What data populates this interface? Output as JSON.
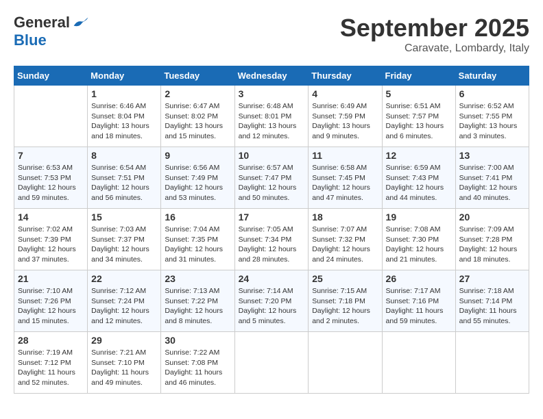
{
  "header": {
    "logo": {
      "general": "General",
      "blue": "Blue"
    },
    "title": "September 2025",
    "subtitle": "Caravate, Lombardy, Italy"
  },
  "calendar": {
    "days": [
      "Sunday",
      "Monday",
      "Tuesday",
      "Wednesday",
      "Thursday",
      "Friday",
      "Saturday"
    ],
    "weeks": [
      [
        {
          "day": null
        },
        {
          "day": "1",
          "sunrise": "Sunrise: 6:46 AM",
          "sunset": "Sunset: 8:04 PM",
          "daylight": "Daylight: 13 hours and 18 minutes."
        },
        {
          "day": "2",
          "sunrise": "Sunrise: 6:47 AM",
          "sunset": "Sunset: 8:02 PM",
          "daylight": "Daylight: 13 hours and 15 minutes."
        },
        {
          "day": "3",
          "sunrise": "Sunrise: 6:48 AM",
          "sunset": "Sunset: 8:01 PM",
          "daylight": "Daylight: 13 hours and 12 minutes."
        },
        {
          "day": "4",
          "sunrise": "Sunrise: 6:49 AM",
          "sunset": "Sunset: 7:59 PM",
          "daylight": "Daylight: 13 hours and 9 minutes."
        },
        {
          "day": "5",
          "sunrise": "Sunrise: 6:51 AM",
          "sunset": "Sunset: 7:57 PM",
          "daylight": "Daylight: 13 hours and 6 minutes."
        },
        {
          "day": "6",
          "sunrise": "Sunrise: 6:52 AM",
          "sunset": "Sunset: 7:55 PM",
          "daylight": "Daylight: 13 hours and 3 minutes."
        }
      ],
      [
        {
          "day": "7",
          "sunrise": "Sunrise: 6:53 AM",
          "sunset": "Sunset: 7:53 PM",
          "daylight": "Daylight: 12 hours and 59 minutes."
        },
        {
          "day": "8",
          "sunrise": "Sunrise: 6:54 AM",
          "sunset": "Sunset: 7:51 PM",
          "daylight": "Daylight: 12 hours and 56 minutes."
        },
        {
          "day": "9",
          "sunrise": "Sunrise: 6:56 AM",
          "sunset": "Sunset: 7:49 PM",
          "daylight": "Daylight: 12 hours and 53 minutes."
        },
        {
          "day": "10",
          "sunrise": "Sunrise: 6:57 AM",
          "sunset": "Sunset: 7:47 PM",
          "daylight": "Daylight: 12 hours and 50 minutes."
        },
        {
          "day": "11",
          "sunrise": "Sunrise: 6:58 AM",
          "sunset": "Sunset: 7:45 PM",
          "daylight": "Daylight: 12 hours and 47 minutes."
        },
        {
          "day": "12",
          "sunrise": "Sunrise: 6:59 AM",
          "sunset": "Sunset: 7:43 PM",
          "daylight": "Daylight: 12 hours and 44 minutes."
        },
        {
          "day": "13",
          "sunrise": "Sunrise: 7:00 AM",
          "sunset": "Sunset: 7:41 PM",
          "daylight": "Daylight: 12 hours and 40 minutes."
        }
      ],
      [
        {
          "day": "14",
          "sunrise": "Sunrise: 7:02 AM",
          "sunset": "Sunset: 7:39 PM",
          "daylight": "Daylight: 12 hours and 37 minutes."
        },
        {
          "day": "15",
          "sunrise": "Sunrise: 7:03 AM",
          "sunset": "Sunset: 7:37 PM",
          "daylight": "Daylight: 12 hours and 34 minutes."
        },
        {
          "day": "16",
          "sunrise": "Sunrise: 7:04 AM",
          "sunset": "Sunset: 7:35 PM",
          "daylight": "Daylight: 12 hours and 31 minutes."
        },
        {
          "day": "17",
          "sunrise": "Sunrise: 7:05 AM",
          "sunset": "Sunset: 7:34 PM",
          "daylight": "Daylight: 12 hours and 28 minutes."
        },
        {
          "day": "18",
          "sunrise": "Sunrise: 7:07 AM",
          "sunset": "Sunset: 7:32 PM",
          "daylight": "Daylight: 12 hours and 24 minutes."
        },
        {
          "day": "19",
          "sunrise": "Sunrise: 7:08 AM",
          "sunset": "Sunset: 7:30 PM",
          "daylight": "Daylight: 12 hours and 21 minutes."
        },
        {
          "day": "20",
          "sunrise": "Sunrise: 7:09 AM",
          "sunset": "Sunset: 7:28 PM",
          "daylight": "Daylight: 12 hours and 18 minutes."
        }
      ],
      [
        {
          "day": "21",
          "sunrise": "Sunrise: 7:10 AM",
          "sunset": "Sunset: 7:26 PM",
          "daylight": "Daylight: 12 hours and 15 minutes."
        },
        {
          "day": "22",
          "sunrise": "Sunrise: 7:12 AM",
          "sunset": "Sunset: 7:24 PM",
          "daylight": "Daylight: 12 hours and 12 minutes."
        },
        {
          "day": "23",
          "sunrise": "Sunrise: 7:13 AM",
          "sunset": "Sunset: 7:22 PM",
          "daylight": "Daylight: 12 hours and 8 minutes."
        },
        {
          "day": "24",
          "sunrise": "Sunrise: 7:14 AM",
          "sunset": "Sunset: 7:20 PM",
          "daylight": "Daylight: 12 hours and 5 minutes."
        },
        {
          "day": "25",
          "sunrise": "Sunrise: 7:15 AM",
          "sunset": "Sunset: 7:18 PM",
          "daylight": "Daylight: 12 hours and 2 minutes."
        },
        {
          "day": "26",
          "sunrise": "Sunrise: 7:17 AM",
          "sunset": "Sunset: 7:16 PM",
          "daylight": "Daylight: 11 hours and 59 minutes."
        },
        {
          "day": "27",
          "sunrise": "Sunrise: 7:18 AM",
          "sunset": "Sunset: 7:14 PM",
          "daylight": "Daylight: 11 hours and 55 minutes."
        }
      ],
      [
        {
          "day": "28",
          "sunrise": "Sunrise: 7:19 AM",
          "sunset": "Sunset: 7:12 PM",
          "daylight": "Daylight: 11 hours and 52 minutes."
        },
        {
          "day": "29",
          "sunrise": "Sunrise: 7:21 AM",
          "sunset": "Sunset: 7:10 PM",
          "daylight": "Daylight: 11 hours and 49 minutes."
        },
        {
          "day": "30",
          "sunrise": "Sunrise: 7:22 AM",
          "sunset": "Sunset: 7:08 PM",
          "daylight": "Daylight: 11 hours and 46 minutes."
        },
        {
          "day": null
        },
        {
          "day": null
        },
        {
          "day": null
        },
        {
          "day": null
        }
      ]
    ]
  }
}
